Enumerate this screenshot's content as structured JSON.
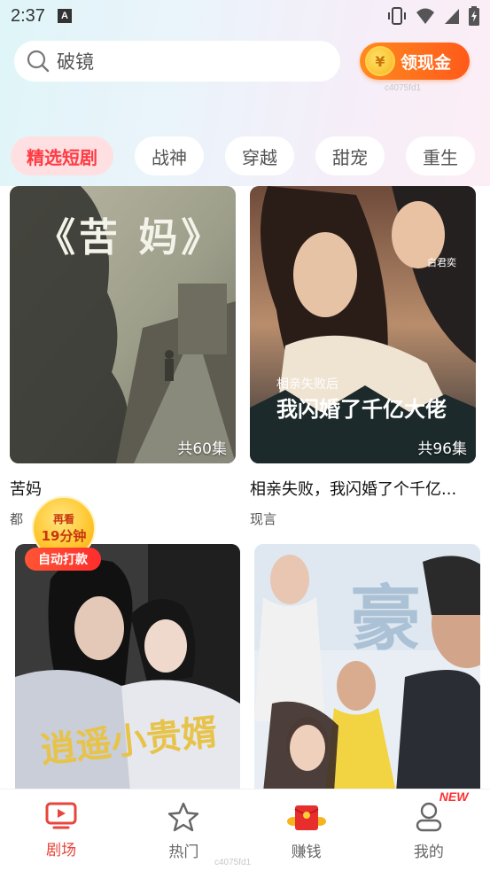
{
  "status_bar": {
    "time": "2:37",
    "notif_letter": "A"
  },
  "search": {
    "placeholder_text": "破镜"
  },
  "cash_button": {
    "label": "领现金",
    "coin_symbol": "¥"
  },
  "watermark": "c4075fd1",
  "category_tabs": [
    {
      "label": "精选短剧",
      "active": true
    },
    {
      "label": "战神",
      "active": false
    },
    {
      "label": "穿越",
      "active": false
    },
    {
      "label": "甜宠",
      "active": false
    },
    {
      "label": "重生",
      "active": false
    }
  ],
  "dramas": [
    {
      "poster_text": "《苦 妈》",
      "episodes": "共60集",
      "title": "苦妈",
      "tag": "都"
    },
    {
      "poster_text": "我闪婚了千亿大佬",
      "poster_subtitle": "相亲失败后",
      "poster_credit": "白君奕",
      "episodes": "共96集",
      "title": "相亲失败，我闪婚了个千亿...",
      "tag": "现言"
    },
    {
      "poster_text": "逍遥小贵婿"
    },
    {
      "poster_text": "豪"
    }
  ],
  "reward_popup": {
    "line1": "再看",
    "line2": "19分钟",
    "button": "自动打款"
  },
  "bottom_nav": [
    {
      "label": "剧场",
      "icon": "tv-play-icon",
      "active": true
    },
    {
      "label": "热门",
      "icon": "star-icon",
      "active": false
    },
    {
      "label": "赚钱",
      "icon": "red-envelope-icon",
      "active": false
    },
    {
      "label": "我的",
      "icon": "user-icon",
      "active": false,
      "badge": "NEW"
    }
  ],
  "colors": {
    "accent": "#ff3b44",
    "nav_active": "#e8453c",
    "cash_orange": "#ff6a1c"
  }
}
